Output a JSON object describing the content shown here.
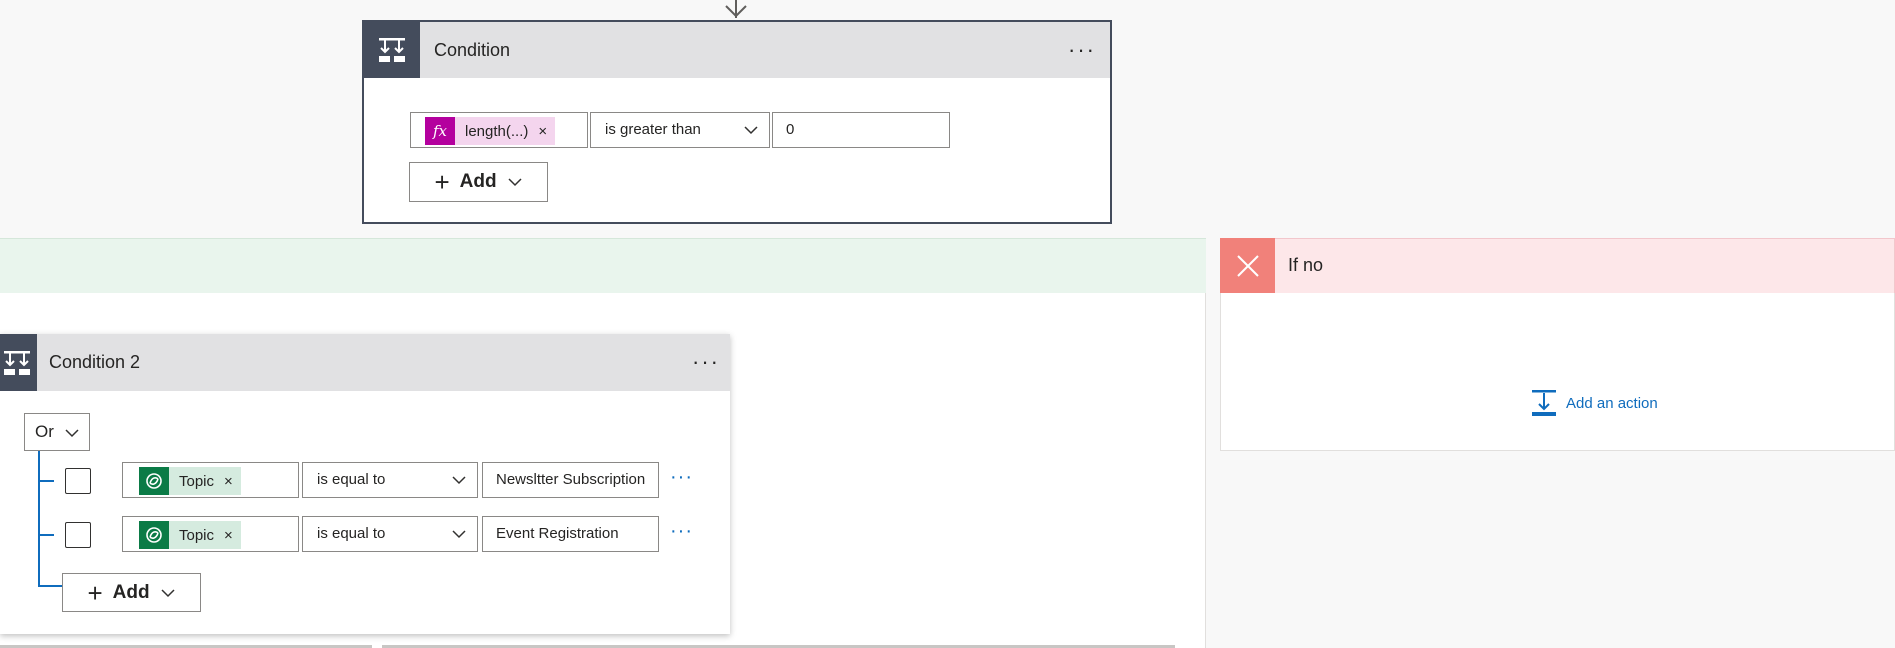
{
  "condition1": {
    "title": "Condition",
    "more": "···",
    "row": {
      "token_label": "length(...)",
      "token_icon": "fx-icon",
      "token_close": "×",
      "operator": "is greater than",
      "value": "0"
    },
    "add_label": "Add"
  },
  "condition2": {
    "title": "Condition 2",
    "more": "···",
    "group_operator": "Or",
    "rows": [
      {
        "token_label": "Topic",
        "token_icon": "dataverse-icon",
        "token_close": "×",
        "operator": "is equal to",
        "value": "Newsltter Subscription",
        "more": "···"
      },
      {
        "token_label": "Topic",
        "token_icon": "dataverse-icon",
        "token_close": "×",
        "operator": "is equal to",
        "value": "Event Registration",
        "more": "···"
      }
    ],
    "add_label": "Add"
  },
  "if_no": {
    "title": "If no",
    "add_action": "Add an action"
  },
  "colors": {
    "header_bg": "#e1e1e3",
    "icon_bg": "#444c5c",
    "fx_token": "#b4009e",
    "fx_token_bg": "#f4d5ee",
    "dataverse_token": "#0b7b46",
    "dataverse_token_bg": "#d5ebdf",
    "if_yes_band": "#e9f5ed",
    "if_no_band": "#fde7e9",
    "if_no_icon": "#f1817a",
    "link": "#0f6cbd"
  }
}
